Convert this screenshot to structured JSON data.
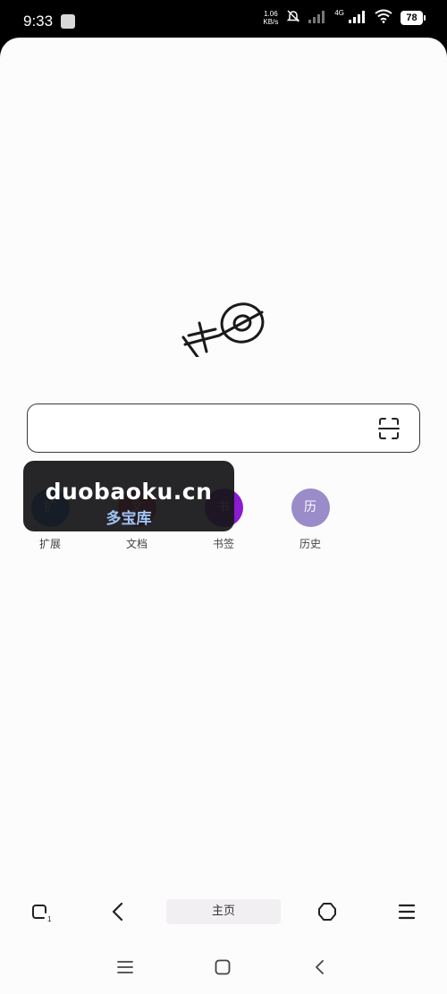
{
  "status_bar": {
    "time": "9:33",
    "net_speed_value": "1.06",
    "net_speed_unit": "KB/s",
    "network_type": "4G",
    "battery": "78",
    "icons": [
      "app-notification-icon",
      "mute-icon",
      "signal-icon",
      "signal-icon",
      "wifi-icon",
      "battery-icon"
    ]
  },
  "search": {
    "value": "",
    "placeholder": ""
  },
  "shortcuts": [
    {
      "label": "扩展",
      "glyph": "扩",
      "color": "#2f7fdc"
    },
    {
      "label": "文档",
      "glyph": "文",
      "color": "#e0405e"
    },
    {
      "label": "书签",
      "glyph": "书",
      "color": "#8a1bd2"
    },
    {
      "label": "历史",
      "glyph": "历",
      "color": "#9a8bc9"
    }
  ],
  "watermark": {
    "main": "duobaoku.cn",
    "sub": "多宝库"
  },
  "bottom_bar": {
    "tab_count": "1",
    "home_label": "主页",
    "icons": [
      "tabs-icon",
      "back-icon",
      "home-label",
      "hexagon-icon",
      "menu-icon"
    ]
  },
  "system_nav": {
    "icons": [
      "recents-icon",
      "home-icon",
      "back-icon"
    ]
  }
}
